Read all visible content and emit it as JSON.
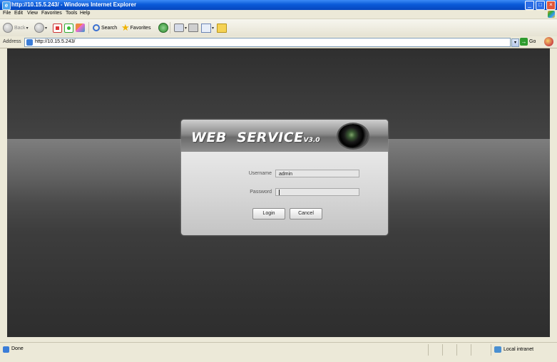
{
  "window": {
    "title": "http://10.15.5.243/ - Windows Internet Explorer",
    "app_icon": "ie-icon",
    "min": "_",
    "max": "□",
    "close": "×"
  },
  "menu": {
    "items": [
      "File",
      "Edit",
      "View",
      "Favorites",
      "Tools",
      "Help"
    ]
  },
  "toolbar": {
    "back": "Back",
    "search": "Search",
    "favorites": "Favorites"
  },
  "address": {
    "label": "Address",
    "url": "http://10.15.5.243/",
    "go": "Go"
  },
  "login": {
    "title": "WEB  SERVICE",
    "version": "V3.0",
    "username_label": "Username",
    "username_value": "admin",
    "password_label": "Password",
    "password_value": "",
    "login_button": "Login",
    "cancel_button": "Cancel"
  },
  "status": {
    "text": "Done",
    "zone": "Local intranet"
  }
}
